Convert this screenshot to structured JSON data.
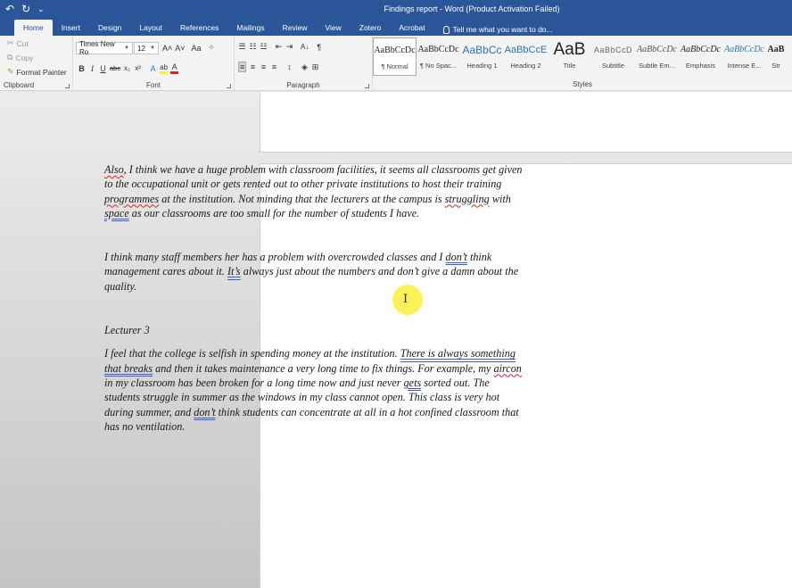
{
  "window": {
    "title": "Findings report - Word (Product Activation Failed)",
    "qat": {
      "undo": "↶",
      "redo": "↻",
      "more": "⌄"
    }
  },
  "tabs": [
    {
      "label": "Home",
      "active": true
    },
    {
      "label": "Insert"
    },
    {
      "label": "Design"
    },
    {
      "label": "Layout"
    },
    {
      "label": "References"
    },
    {
      "label": "Mailings"
    },
    {
      "label": "Review"
    },
    {
      "label": "View"
    },
    {
      "label": "Zotero"
    },
    {
      "label": "Acrobat"
    }
  ],
  "tellme": "Tell me what you want to do...",
  "ribbon": {
    "clipboard": {
      "cut": "Cut",
      "copy": "Copy",
      "format_painter": "Format Painter",
      "label": "Clipboard"
    },
    "font": {
      "name": "Times New Ro",
      "size": "12",
      "grow": "A˄",
      "shrink": "A˅",
      "case": "Aa",
      "clear": "✧",
      "bold": "B",
      "italic": "I",
      "underline": "U",
      "strike": "abc",
      "subscript": "x₂",
      "superscript": "x²",
      "effects": "A",
      "highlight": "ab",
      "color": "A",
      "label": "Font"
    },
    "paragraph": {
      "bullets": "☰",
      "numbering": "☷",
      "multilevel": "☳",
      "dec_indent": "⇤",
      "inc_indent": "⇥",
      "sort": "A↓",
      "pilcrow": "¶",
      "align_left": "≡",
      "align_center": "≡",
      "align_right": "≡",
      "justify": "≡",
      "spacing": "↕",
      "shading": "◈",
      "borders": "⊞",
      "label": "Paragraph"
    },
    "styles": {
      "label": "Styles",
      "items": [
        {
          "preview": "AaBbCcDc",
          "name": "¶ Normal",
          "selected": true
        },
        {
          "preview": "AaBbCcDc",
          "name": "¶ No Spac..."
        },
        {
          "preview": "AaBbCc",
          "name": "Heading 1"
        },
        {
          "preview": "AaBbCcE",
          "name": "Heading 2"
        },
        {
          "preview": "AaB",
          "name": "Title"
        },
        {
          "preview": "AaBbCcD",
          "name": "Subtitle"
        },
        {
          "preview": "AaBbCcDc",
          "name": "Subtle Em..."
        },
        {
          "preview": "AaBbCcDc",
          "name": "Emphasis"
        },
        {
          "preview": "AaBbCcDc",
          "name": "Intense E..."
        },
        {
          "preview": "AaB",
          "name": "Str"
        }
      ]
    }
  },
  "colors": {
    "accent": "#2b579a",
    "heading_blue": "#2e74b5",
    "spell_error": "#d22222",
    "highlighter": "#faf03c"
  },
  "document": {
    "p1": {
      "w_also": "Also",
      "t1": ", I think we have a huge problem with classroom facilities, it seems all classrooms get given to the occupational unit or gets rented out to other private institutions to host their training ",
      "w_programmes": "programmes",
      "t2": " at the institution. Not minding that the lecturers at the campus is ",
      "w_struggling": "struggling",
      "t3": " with ",
      "w_space": "space",
      "t4": " as our classrooms are too small for the number of students I have."
    },
    "p2": {
      "t1": "I think many staff members her has a problem with overcrowded classes and I ",
      "w_dont": "don’t",
      "t2": " think management cares about it. ",
      "w_its": "It’s",
      "t3": " always just about the numbers and don’t give a damn about the quality."
    },
    "p3": "Lecturer 3",
    "p4": {
      "t1": "I feel that the college is selfish in spending money at the institution. ",
      "w_there": "There is always something that breaks",
      "t2": " and then it takes maintenance a very long time to fix things. For example, my ",
      "w_aircon": "aircon",
      "t3": " in my classroom has been broken for a long time now and just never ",
      "w_gets": "gets",
      "t4": " sorted out. The students struggle in summer as the windows in my class cannot open. This class is very hot during summer, and ",
      "w_dont": "don’t",
      "t5": " think students can concentrate at all in a hot confined classroom that has no ventilation."
    }
  },
  "cursor": "I"
}
